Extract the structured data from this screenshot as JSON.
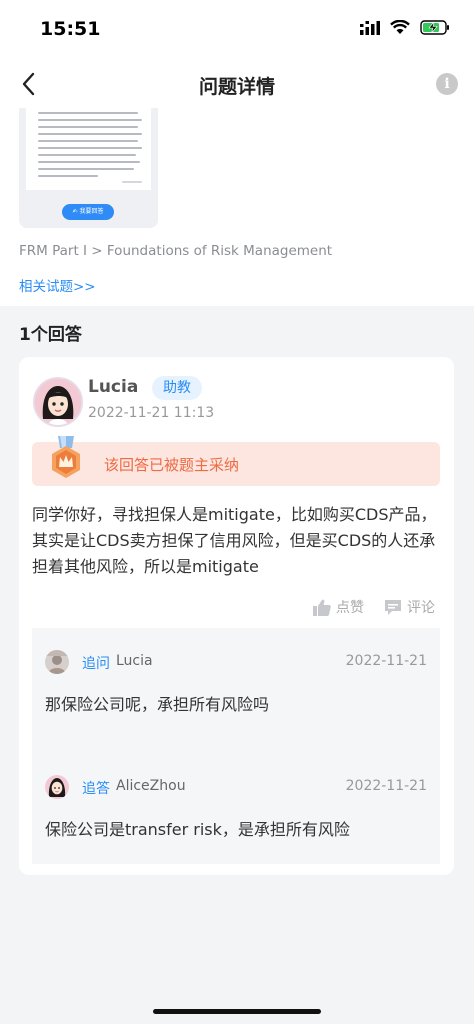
{
  "status_bar": {
    "time": "15:51"
  },
  "nav": {
    "title": "问题详情",
    "info_glyph": "i"
  },
  "question": {
    "image_button_label": "✍ 我要回答",
    "breadcrumb": "FRM Part I > Foundations of Risk Management",
    "related_link": "相关试题>>"
  },
  "answers": {
    "count_label": "1个回答",
    "items": [
      {
        "user": "Lucia",
        "role": "助教",
        "time": "2022-11-21 11:13",
        "accepted_text": "该回答已被题主采纳",
        "body": "同学你好，寻找担保人是mitigate，比如购买CDS产品，其实是让CDS卖方担保了信用风险，但是买CDS的人还承担着其他风险，所以是mitigate",
        "like_label": "点赞",
        "comment_label": "评论",
        "followups": [
          {
            "tag": "追问",
            "user": "Lucia",
            "date": "2022-11-21",
            "text": "那保险公司呢，承担所有风险吗"
          },
          {
            "tag": "追答",
            "user": "AliceZhou",
            "date": "2022-11-21",
            "text": "保险公司是transfer risk，是承担所有风险"
          }
        ]
      }
    ]
  },
  "colors": {
    "accent": "#2a8df6",
    "accepted_bg": "#fde6df",
    "accepted_text": "#ed6a44",
    "page_bg": "#f3f4f6"
  }
}
